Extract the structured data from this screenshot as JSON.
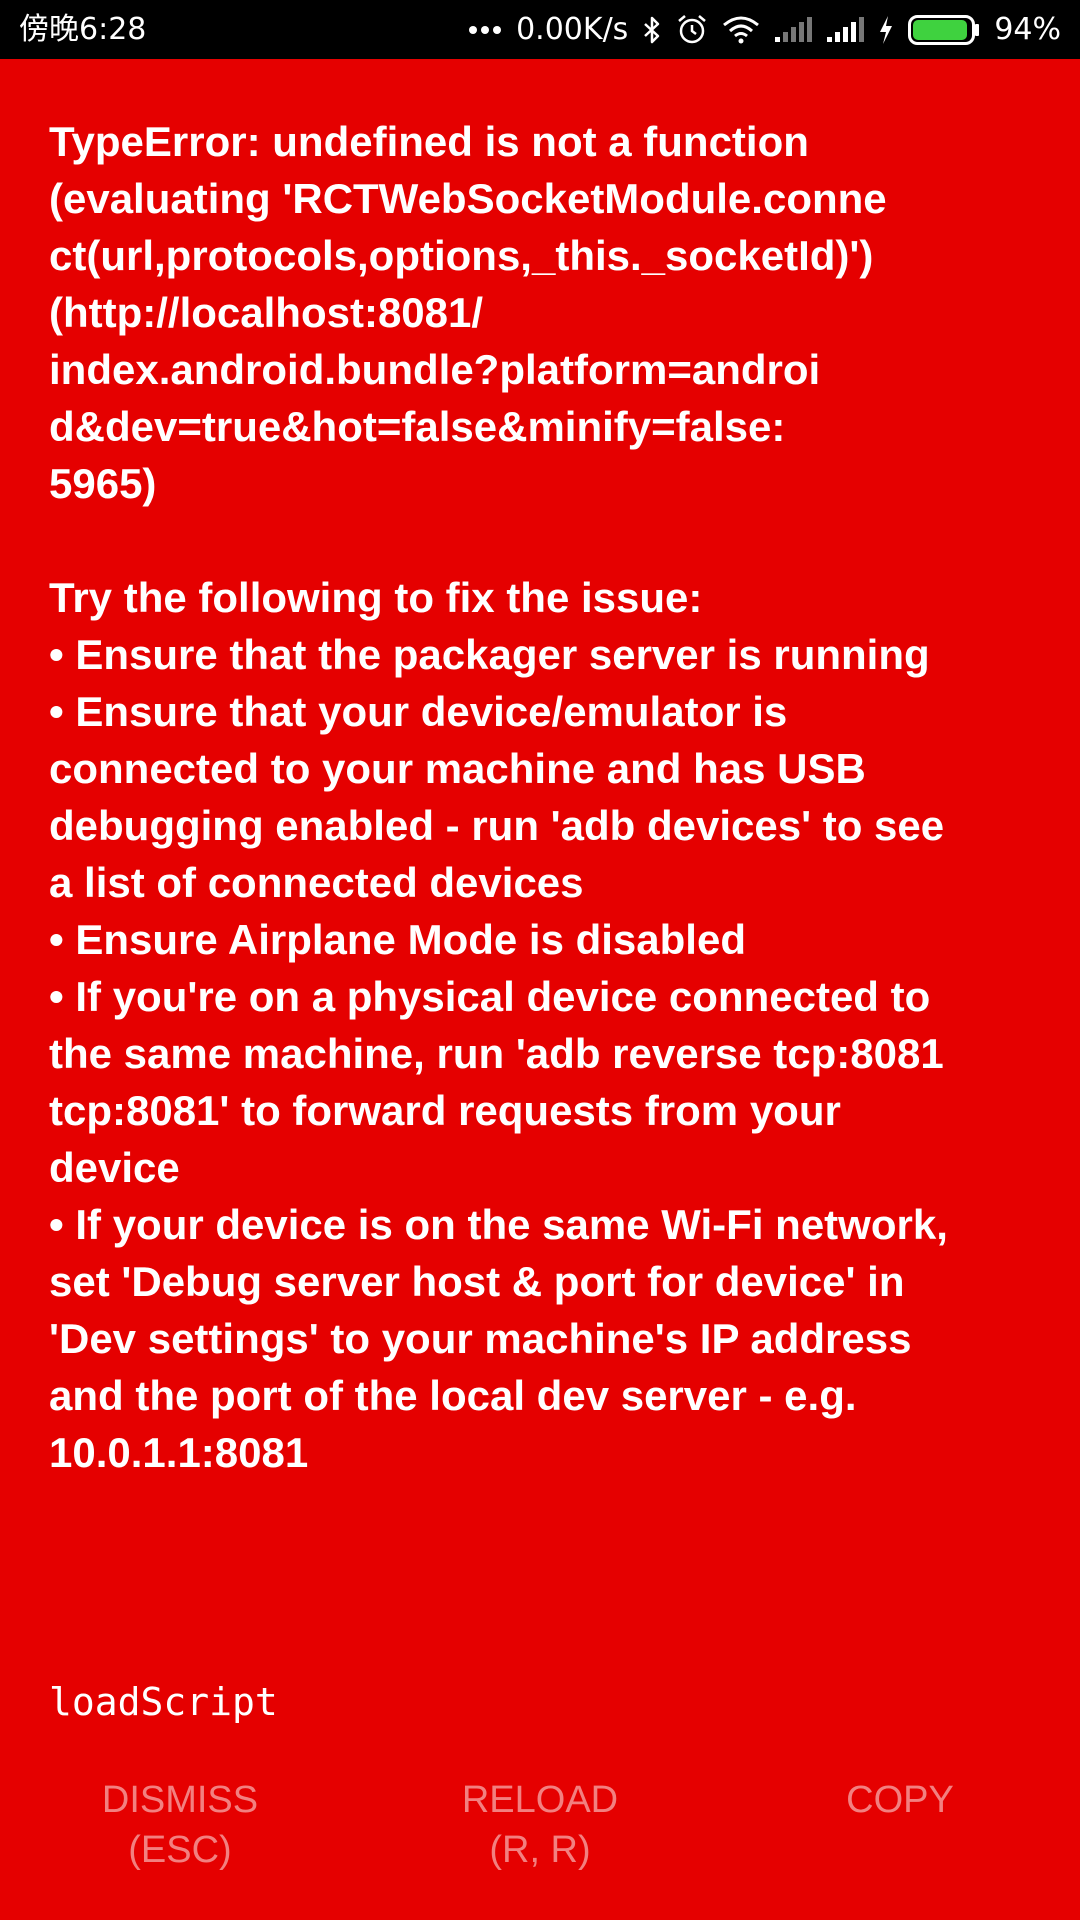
{
  "status_bar": {
    "time": "傍晚6:28",
    "network_speed": "0.00K/s",
    "battery_percent": "94%",
    "icons": [
      "more-dots-icon",
      "bluetooth-icon",
      "alarm-icon",
      "wifi-icon",
      "signal-icon",
      "signal-icon",
      "charging-icon",
      "battery-icon"
    ],
    "battery_level": 0.94
  },
  "error": {
    "lines": [
      "TypeError: undefined is not a function",
      "(evaluating 'RCTWebSocketModule.conne",
      "ct(url,protocols,options,_this._socketId)')",
      "(http://localhost:8081/",
      "index.android.bundle?platform=androi",
      "d&dev=true&hot=false&minify=false:",
      "5965)",
      "",
      "Try the following to fix the issue:",
      "• Ensure that the packager server is running",
      "• Ensure that your device/emulator is",
      "connected to your machine and has USB",
      "debugging enabled - run 'adb devices' to see",
      "a list of connected devices",
      "• Ensure Airplane Mode is disabled",
      "• If you're on a physical device connected to",
      "the same machine, run 'adb reverse tcp:8081",
      "tcp:8081' to forward requests from your",
      "device",
      "• If your device is on the same Wi-Fi network,",
      "set 'Debug server host & port for device' in",
      "'Dev settings' to your machine's IP address",
      "and the port of the local dev server - e.g.",
      "10.0.1.1:8081"
    ]
  },
  "stack": {
    "label": "loadScript"
  },
  "buttons": {
    "dismiss": {
      "label": "DISMISS",
      "shortcut": "(ESC)"
    },
    "reload": {
      "label": "RELOAD",
      "shortcut": "(R, R)"
    },
    "copy": {
      "label": "COPY"
    }
  },
  "colors": {
    "background": "#e50000",
    "status_bar": "#000000",
    "text": "#ffffff",
    "button_text": "#f28080",
    "battery_fill": "#3fd23f"
  }
}
